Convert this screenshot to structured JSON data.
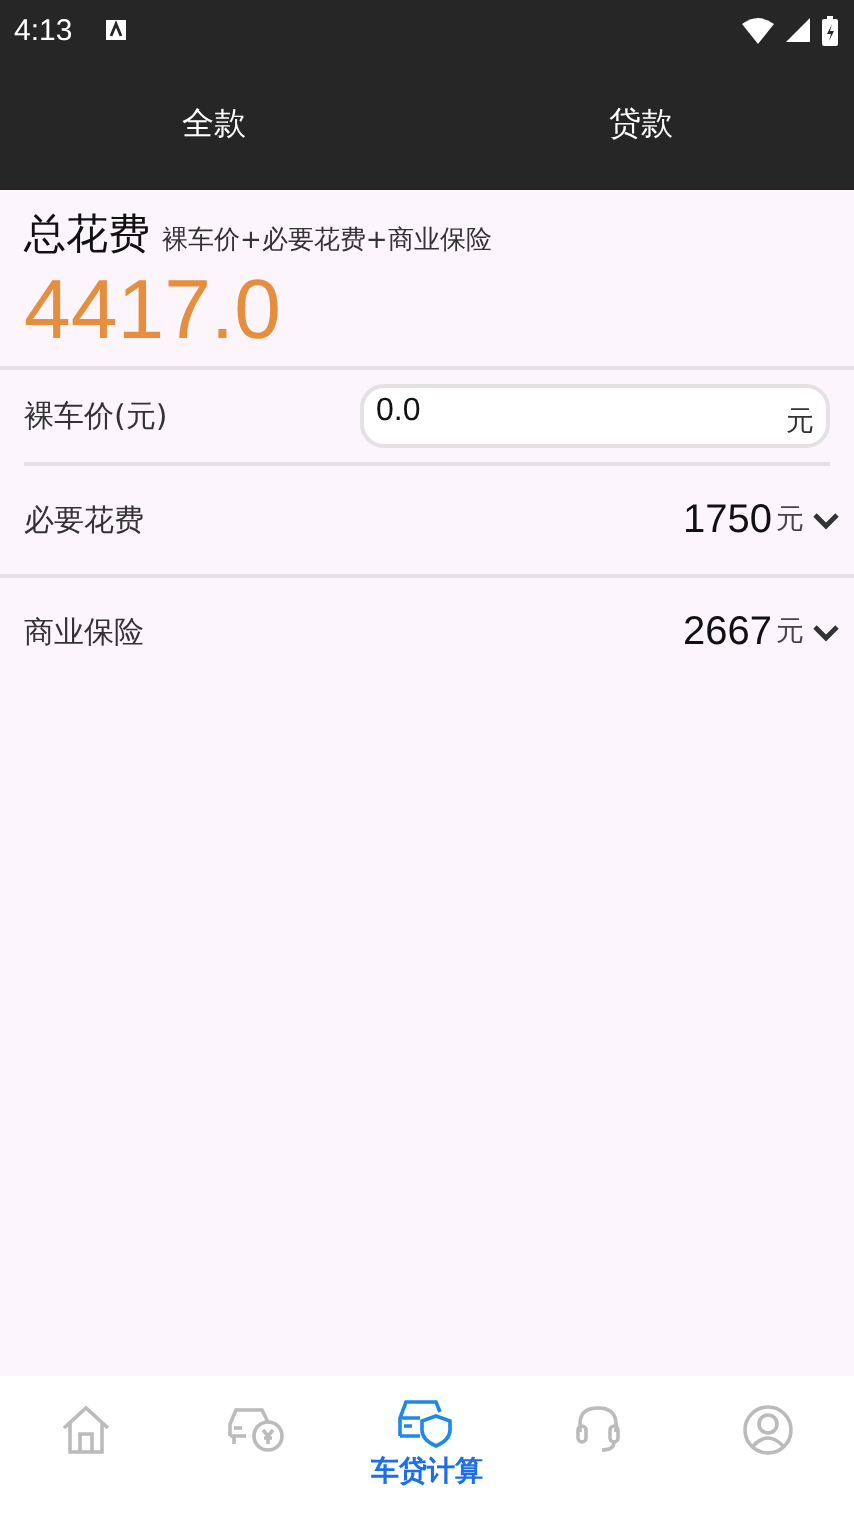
{
  "status_bar": {
    "time": "4:13"
  },
  "tabs": [
    {
      "label": "全款"
    },
    {
      "label": "贷款"
    }
  ],
  "summary": {
    "title": "总花费",
    "formula": "裸车价+必要花费+商业保险",
    "total": "4417.0"
  },
  "price_field": {
    "label": "裸车价(元)",
    "value": "0.0",
    "unit": "元"
  },
  "rows": [
    {
      "label": "必要花费",
      "value": "1750",
      "unit": "元"
    },
    {
      "label": "商业保险",
      "value": "2667",
      "unit": "元"
    }
  ],
  "bottom_nav": [
    {
      "kind": "home",
      "selected": false
    },
    {
      "kind": "car-money",
      "selected": false
    },
    {
      "kind": "car-shield",
      "selected": true,
      "label": "车贷计算"
    },
    {
      "kind": "headset",
      "selected": false
    },
    {
      "kind": "person",
      "selected": false
    }
  ]
}
